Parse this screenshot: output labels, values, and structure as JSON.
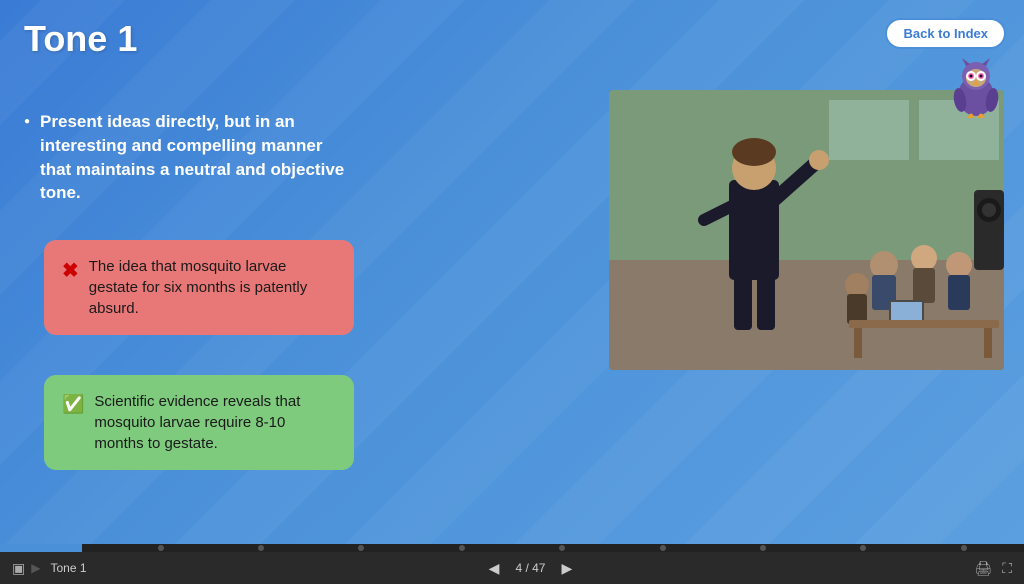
{
  "header": {
    "title": "Tone 1",
    "back_button_label": "Back to Index"
  },
  "content": {
    "bullet_text": "Present ideas directly, but in an interesting and compelling manner that maintains a neutral and objective tone.",
    "red_box": {
      "icon": "✗",
      "text": "The idea that mosquito larvae gestate for six months is patently absurd."
    },
    "green_box": {
      "icon": "✓",
      "text": "Scientific evidence reveals that mosquito larvae require 8-10 months to gestate."
    }
  },
  "footer": {
    "slide_label": "Tone 1",
    "current_page": "4",
    "total_pages": "47",
    "page_display": "4 / 47"
  },
  "colors": {
    "background": "#4a8fd4",
    "title_color": "#ffffff",
    "red_box_bg": "#e87878",
    "green_box_bg": "#7ecb7e",
    "bottom_bar": "#2a2a2a"
  }
}
